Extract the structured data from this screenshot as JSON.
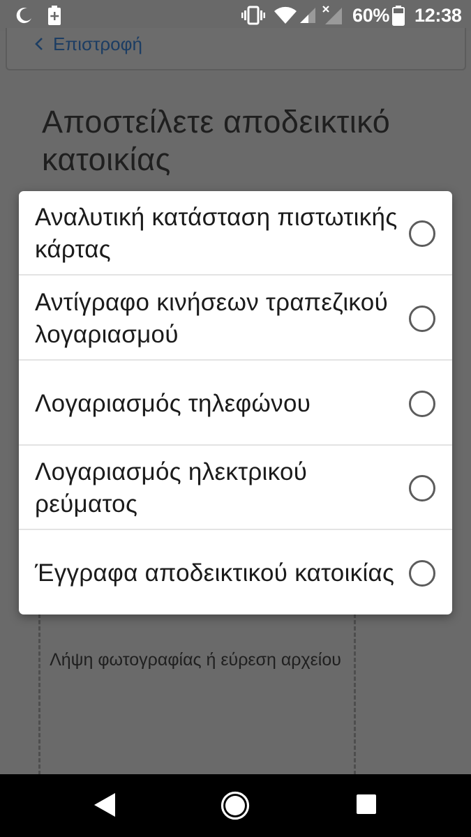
{
  "status_bar": {
    "battery_percent": "60%",
    "time": "12:38",
    "icons": [
      "moon-icon",
      "battery-saver-icon",
      "vibrate-icon",
      "wifi-icon",
      "cell-signal-icon",
      "cell-signal-no-sim-icon",
      "battery-icon"
    ]
  },
  "topbar": {
    "back_label": "Επιστροφή"
  },
  "page": {
    "title": "Αποστείλετε αποδεικτικό κατοικίας",
    "upload_hint": "Λήψη φωτογραφίας ή εύρεση αρχείου"
  },
  "dialog": {
    "options": [
      {
        "label": "Αναλυτική κατάσταση πιστωτικής κάρτας",
        "selected": false
      },
      {
        "label": "Αντίγραφο κινήσεων τραπεζικού λογαριασμού",
        "selected": false
      },
      {
        "label": "Λογαριασμός τηλεφώνου",
        "selected": false
      },
      {
        "label": "Λογαριασμός ηλεκτρικού ρεύματος",
        "selected": false
      },
      {
        "label": "Έγγραφα αποδεικτικού κατοικίας",
        "selected": false
      }
    ]
  },
  "nav_bar": {
    "icons": [
      "back-triangle-icon",
      "home-circle-icon",
      "recents-square-icon"
    ]
  },
  "colors": {
    "scrim": "#696969",
    "dialog_bg": "#ffffff",
    "link": "#1c3d63",
    "nav_bar": "#000000"
  }
}
